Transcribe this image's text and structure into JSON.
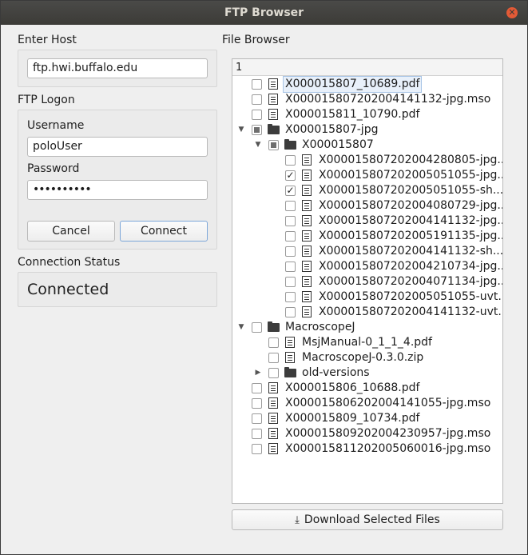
{
  "window": {
    "title": "FTP Browser"
  },
  "host": {
    "label": "Enter Host",
    "value": "ftp.hwi.buffalo.edu"
  },
  "logon": {
    "label": "FTP Logon",
    "username_label": "Username",
    "username_value": "poloUser",
    "password_label": "Password",
    "password_value": "••••••••••",
    "cancel_label": "Cancel",
    "connect_label": "Connect"
  },
  "status": {
    "label": "Connection Status",
    "value": "Connected"
  },
  "browser": {
    "label": "File Browser",
    "header": "1",
    "download_label": "Download Selected Files",
    "items": [
      {
        "name": "X000015807_10689.pdf",
        "type": "file",
        "depth": 0,
        "checked": "none",
        "selected": true
      },
      {
        "name": "X000015807202004141132-jpg.mso",
        "type": "file",
        "depth": 0,
        "checked": "none"
      },
      {
        "name": "X000015811_10790.pdf",
        "type": "file",
        "depth": 0,
        "checked": "none"
      },
      {
        "name": "X000015807-jpg",
        "type": "folder",
        "depth": 0,
        "checked": "partial",
        "expanded": true
      },
      {
        "name": "X000015807",
        "type": "folder",
        "depth": 1,
        "checked": "partial",
        "expanded": true
      },
      {
        "name": "X000015807202004280805-jpg...",
        "type": "file",
        "depth": 2,
        "checked": "none"
      },
      {
        "name": "X000015807202005051055-jpg...",
        "type": "file",
        "depth": 2,
        "checked": "checked"
      },
      {
        "name": "X000015807202005051055-sh...",
        "type": "file",
        "depth": 2,
        "checked": "checked"
      },
      {
        "name": "X000015807202004080729-jpg...",
        "type": "file",
        "depth": 2,
        "checked": "none"
      },
      {
        "name": "X000015807202004141132-jpg...",
        "type": "file",
        "depth": 2,
        "checked": "none"
      },
      {
        "name": "X000015807202005191135-jpg...",
        "type": "file",
        "depth": 2,
        "checked": "none"
      },
      {
        "name": "X000015807202004141132-sh...",
        "type": "file",
        "depth": 2,
        "checked": "none"
      },
      {
        "name": "X000015807202004210734-jpg...",
        "type": "file",
        "depth": 2,
        "checked": "none"
      },
      {
        "name": "X000015807202004071134-jpg...",
        "type": "file",
        "depth": 2,
        "checked": "none"
      },
      {
        "name": "X000015807202005051055-uvt...",
        "type": "file",
        "depth": 2,
        "checked": "none"
      },
      {
        "name": "X000015807202004141132-uvt...",
        "type": "file",
        "depth": 2,
        "checked": "none"
      },
      {
        "name": "MacroscopeJ",
        "type": "folder",
        "depth": 0,
        "checked": "none",
        "expanded": true
      },
      {
        "name": "MsjManual-0_1_1_4.pdf",
        "type": "file",
        "depth": 1,
        "checked": "none"
      },
      {
        "name": "MacroscopeJ-0.3.0.zip",
        "type": "file",
        "depth": 1,
        "checked": "none"
      },
      {
        "name": "old-versions",
        "type": "folder",
        "depth": 1,
        "checked": "none",
        "expanded": false
      },
      {
        "name": "X000015806_10688.pdf",
        "type": "file",
        "depth": 0,
        "checked": "none"
      },
      {
        "name": "X000015806202004141055-jpg.mso",
        "type": "file",
        "depth": 0,
        "checked": "none"
      },
      {
        "name": "X000015809_10734.pdf",
        "type": "file",
        "depth": 0,
        "checked": "none"
      },
      {
        "name": "X000015809202004230957-jpg.mso",
        "type": "file",
        "depth": 0,
        "checked": "none"
      },
      {
        "name": "X000015811202005060016-jpg.mso",
        "type": "file",
        "depth": 0,
        "checked": "none"
      }
    ]
  }
}
